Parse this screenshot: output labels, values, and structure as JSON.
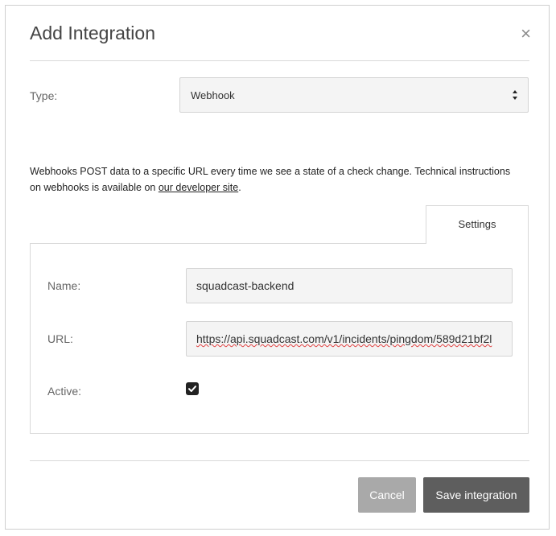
{
  "dialog": {
    "title": "Add Integration",
    "close_glyph": "×"
  },
  "type_field": {
    "label": "Type:",
    "selected": "Webhook",
    "icon": "select-arrows-icon"
  },
  "description": {
    "text_before_link": "Webhooks POST data to a specific URL every time we see a state of a check change. Technical instructions on webhooks is available on ",
    "link_text": "our developer site",
    "text_after_link": "."
  },
  "tabs": [
    {
      "label": "Settings",
      "active": true
    }
  ],
  "settings": {
    "name": {
      "label": "Name:",
      "value": "squadcast-backend"
    },
    "url": {
      "label": "URL:",
      "value": "https://api.squadcast.com/v1/incidents/pingdom/589d21bf2l"
    },
    "active": {
      "label": "Active:",
      "checked": true,
      "icon": "checkmark-icon"
    }
  },
  "buttons": {
    "cancel": "Cancel",
    "save": "Save integration"
  },
  "colors": {
    "cancel_bg": "#a9a9a9",
    "save_bg": "#5e5e5e",
    "field_bg": "#f4f4f4",
    "border": "#d9d9d9"
  }
}
